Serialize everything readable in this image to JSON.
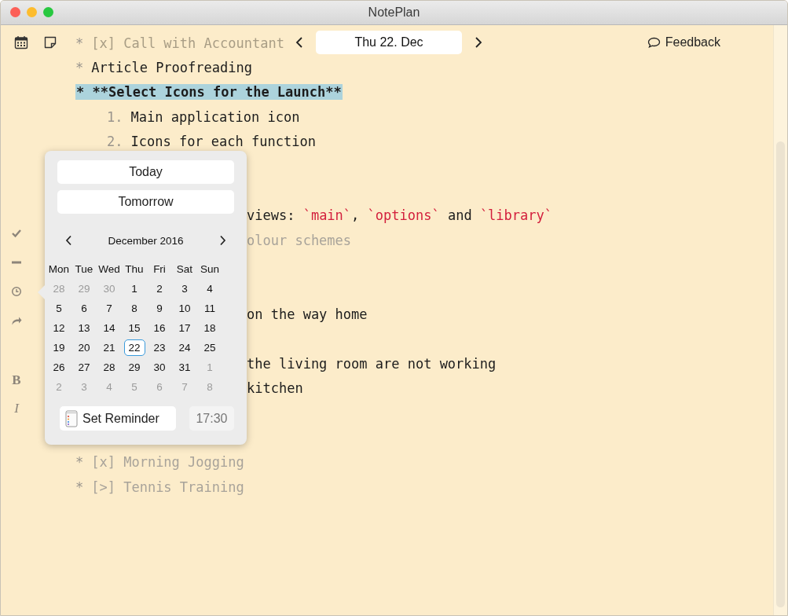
{
  "window": {
    "title": "NotePlan"
  },
  "toolbar": {
    "date": "Thu 22. Dec",
    "feedback": "Feedback"
  },
  "sidebar": {
    "tools": [
      {
        "kind": "check"
      },
      {
        "kind": "minus"
      },
      {
        "kind": "clock"
      },
      {
        "kind": "share"
      }
    ],
    "format": [
      "B",
      "I"
    ]
  },
  "lines": [
    {
      "kind": "ghost",
      "marker": "*",
      "parts": [
        {
          "text": "[x] Call with Accountant"
        }
      ]
    },
    {
      "kind": "bullet",
      "marker": "*",
      "parts": [
        {
          "text": "Article Proofreading"
        }
      ]
    },
    {
      "kind": "highlight",
      "parts": [
        {
          "text": "* **Select Icons for the Launch**"
        }
      ]
    },
    {
      "kind": "numbered",
      "marker": "1.",
      "parts": [
        {
          "text": "Main application icon"
        }
      ]
    },
    {
      "kind": "numbered",
      "marker": "2.",
      "parts": [
        {
          "text": "Icons for each function"
        }
      ]
    },
    {
      "kind": "blank"
    },
    {
      "kind": "blank"
    },
    {
      "kind": "covered",
      "parts": [
        {
          "text": "views: "
        },
        {
          "text": "`main`",
          "code": true
        },
        {
          "text": ", "
        },
        {
          "text": "`options`",
          "code": true
        },
        {
          "text": " and "
        },
        {
          "text": "`library`",
          "code": true
        }
      ]
    },
    {
      "kind": "covered-faded",
      "parts": [
        {
          "text": "olour schemes"
        }
      ]
    },
    {
      "kind": "blank"
    },
    {
      "kind": "blank"
    },
    {
      "kind": "covered",
      "parts": [
        {
          "text": "on the way home"
        }
      ]
    },
    {
      "kind": "blank"
    },
    {
      "kind": "covered",
      "parts": [
        {
          "text": "the living room are not working"
        }
      ]
    },
    {
      "kind": "covered",
      "parts": [
        {
          "text": "kitchen"
        }
      ]
    },
    {
      "kind": "blank"
    },
    {
      "kind": "blank"
    },
    {
      "kind": "done",
      "marker": "*",
      "parts": [
        {
          "text": "[x] Morning Jogging"
        }
      ]
    },
    {
      "kind": "done",
      "marker": "*",
      "parts": [
        {
          "text": "[>] Tennis Training"
        }
      ]
    }
  ],
  "date_picker": {
    "quick": [
      "Today",
      "Tomorrow"
    ],
    "month": "December 2016",
    "weekdays": [
      "Mon",
      "Tue",
      "Wed",
      "Thu",
      "Fri",
      "Sat",
      "Sun"
    ],
    "weeks": [
      [
        {
          "day": "28",
          "muted": true,
          "selected": false
        },
        {
          "day": "29",
          "muted": true,
          "selected": false
        },
        {
          "day": "30",
          "muted": true,
          "selected": false
        },
        {
          "day": "1",
          "muted": false,
          "selected": false
        },
        {
          "day": "2",
          "muted": false,
          "selected": false
        },
        {
          "day": "3",
          "muted": false,
          "selected": false
        },
        {
          "day": "4",
          "muted": false,
          "selected": false
        }
      ],
      [
        {
          "day": "5",
          "muted": false,
          "selected": false
        },
        {
          "day": "6",
          "muted": false,
          "selected": false
        },
        {
          "day": "7",
          "muted": false,
          "selected": false
        },
        {
          "day": "8",
          "muted": false,
          "selected": false
        },
        {
          "day": "9",
          "muted": false,
          "selected": false
        },
        {
          "day": "10",
          "muted": false,
          "selected": false
        },
        {
          "day": "11",
          "muted": false,
          "selected": false
        }
      ],
      [
        {
          "day": "12",
          "muted": false,
          "selected": false
        },
        {
          "day": "13",
          "muted": false,
          "selected": false
        },
        {
          "day": "14",
          "muted": false,
          "selected": false
        },
        {
          "day": "15",
          "muted": false,
          "selected": false
        },
        {
          "day": "16",
          "muted": false,
          "selected": false
        },
        {
          "day": "17",
          "muted": false,
          "selected": false
        },
        {
          "day": "18",
          "muted": false,
          "selected": false
        }
      ],
      [
        {
          "day": "19",
          "muted": false,
          "selected": false
        },
        {
          "day": "20",
          "muted": false,
          "selected": false
        },
        {
          "day": "21",
          "muted": false,
          "selected": false
        },
        {
          "day": "22",
          "muted": false,
          "selected": true
        },
        {
          "day": "23",
          "muted": false,
          "selected": false
        },
        {
          "day": "24",
          "muted": false,
          "selected": false
        },
        {
          "day": "25",
          "muted": false,
          "selected": false
        }
      ],
      [
        {
          "day": "26",
          "muted": false,
          "selected": false
        },
        {
          "day": "27",
          "muted": false,
          "selected": false
        },
        {
          "day": "28",
          "muted": false,
          "selected": false
        },
        {
          "day": "29",
          "muted": false,
          "selected": false
        },
        {
          "day": "30",
          "muted": false,
          "selected": false
        },
        {
          "day": "31",
          "muted": false,
          "selected": false
        },
        {
          "day": "1",
          "muted": true,
          "selected": false
        }
      ],
      [
        {
          "day": "2",
          "muted": true,
          "selected": false
        },
        {
          "day": "3",
          "muted": true,
          "selected": false
        },
        {
          "day": "4",
          "muted": true,
          "selected": false
        },
        {
          "day": "5",
          "muted": true,
          "selected": false
        },
        {
          "day": "6",
          "muted": true,
          "selected": false
        },
        {
          "day": "7",
          "muted": true,
          "selected": false
        },
        {
          "day": "8",
          "muted": true,
          "selected": false
        }
      ]
    ],
    "reminder": "Set Reminder",
    "time": "17:30"
  }
}
